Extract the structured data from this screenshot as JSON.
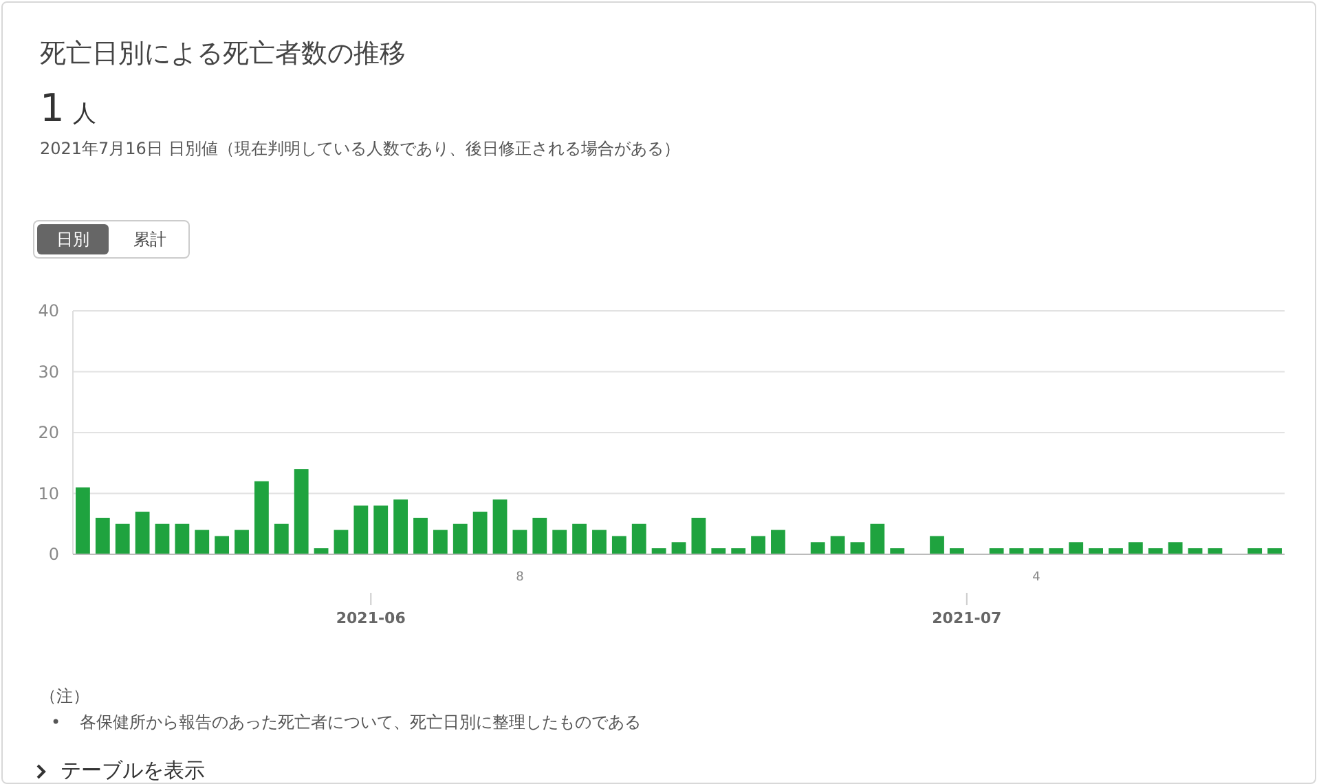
{
  "card": {
    "title": "死亡日別による死亡者数の推移",
    "value": "1",
    "unit": "人",
    "caption": "2021年7月16日 日別値（現在判明している人数であり、後日修正される場合がある）"
  },
  "toggle": [
    {
      "label": "日別",
      "selected": true
    },
    {
      "label": "累計",
      "selected": false
    }
  ],
  "chart_data": {
    "type": "bar",
    "grid": true,
    "categories": [
      null,
      null,
      null,
      null,
      null,
      null,
      null,
      null,
      null,
      null,
      null,
      null,
      null,
      null,
      null,
      null,
      null,
      null,
      null,
      null,
      null,
      null,
      "8",
      null,
      null,
      null,
      null,
      null,
      null,
      null,
      null,
      null,
      null,
      null,
      null,
      null,
      null,
      null,
      null,
      null,
      null,
      null,
      null,
      null,
      null,
      null,
      null,
      null,
      "4",
      null,
      null,
      null,
      null,
      null,
      null,
      null,
      null,
      null,
      null,
      null,
      null
    ],
    "series": [
      {
        "color": "#1fa33f",
        "values": [
          11,
          6,
          5,
          7,
          5,
          5,
          4,
          3,
          4,
          12,
          5,
          14,
          1,
          4,
          8,
          8,
          9,
          6,
          4,
          5,
          7,
          9,
          4,
          6,
          4,
          5,
          4,
          3,
          5,
          1,
          2,
          6,
          1,
          1,
          3,
          4,
          0,
          2,
          3,
          2,
          5,
          1,
          0,
          3,
          1,
          0,
          1,
          1,
          1,
          1,
          2,
          1,
          1,
          2,
          1,
          2,
          1,
          1,
          0,
          1,
          1
        ]
      }
    ],
    "ylim": [
      0,
      40
    ],
    "yticks": [
      0,
      10,
      20,
      30,
      40
    ],
    "annotations": [
      "2021-06",
      "2021-07"
    ]
  },
  "notes": {
    "heading": "（注）",
    "items": [
      {
        "marker": "•",
        "text": "各保健所から報告のあった死亡者について、死亡日別に整理したものである"
      }
    ]
  },
  "table_toggle": {
    "label": "テーブルを表示",
    "expanded": false
  }
}
